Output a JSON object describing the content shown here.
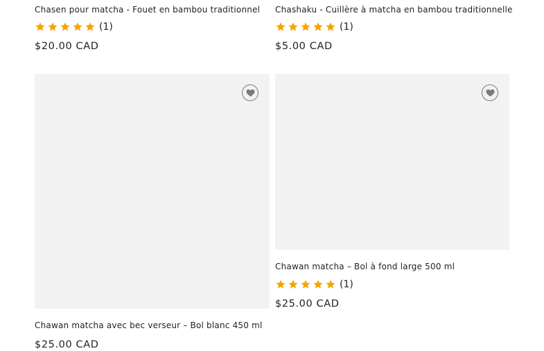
{
  "products": [
    {
      "title": "Chasen pour matcha - Fouet en bambou traditionnel",
      "rating_count": "(1)",
      "price": "$20.00 CAD",
      "rating": 5
    },
    {
      "title": "Chashaku - Cuillère à matcha en bambou traditionnelle",
      "rating_count": "(1)",
      "price": "$5.00 CAD",
      "rating": 5
    },
    {
      "title": "Chawan matcha avec bec verseur – Bol blanc 450 ml",
      "price": "$25.00 CAD"
    },
    {
      "title": "Chawan matcha – Bol à fond large 500 ml",
      "rating_count": "(1)",
      "price": "$25.00 CAD",
      "rating": 5
    }
  ],
  "colors": {
    "star": "#f5a400",
    "image_placeholder": "#f2f2f2",
    "wishlist_icon": "#7a7a7a"
  },
  "icons": {
    "star": "star-icon",
    "wishlist": "heart-icon"
  }
}
